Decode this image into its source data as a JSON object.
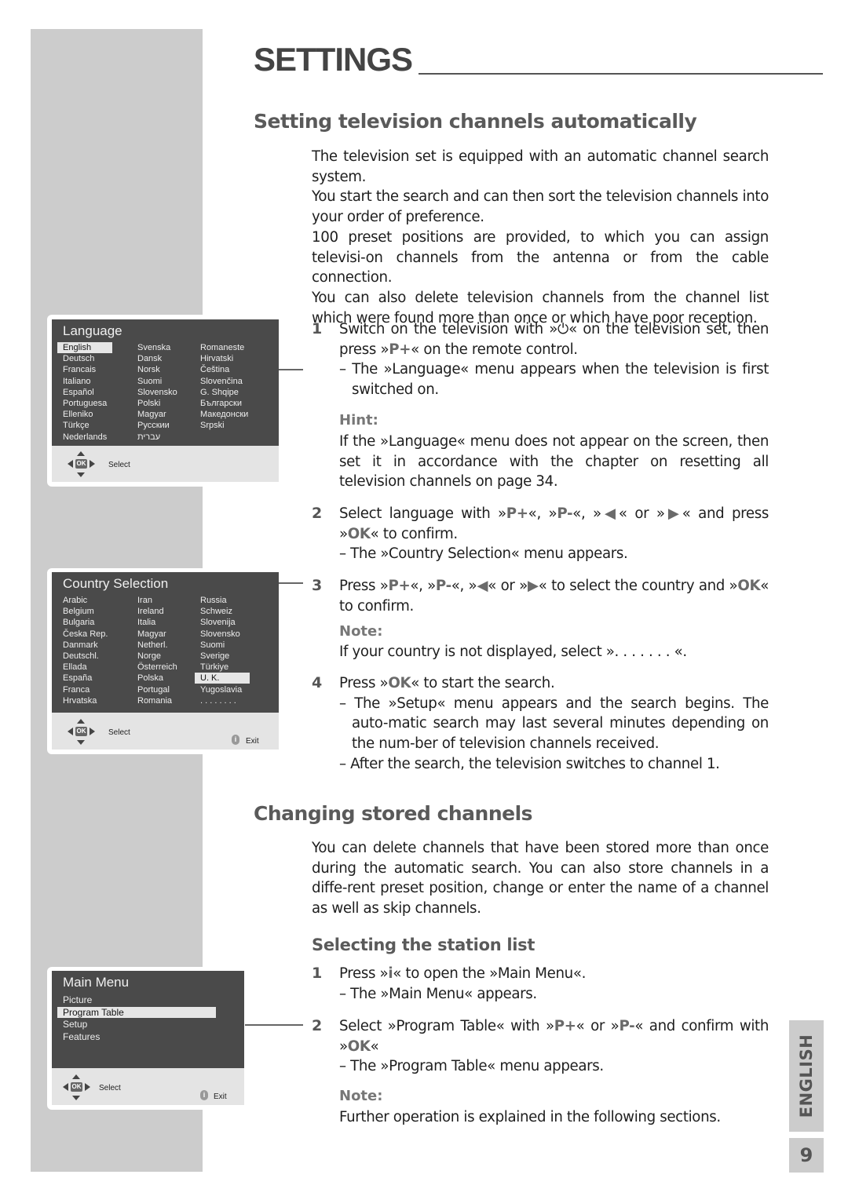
{
  "page": {
    "title": "SETTINGS",
    "language_tab": "ENGLISH",
    "page_number": "9"
  },
  "section1": {
    "heading": "Setting television channels automatically",
    "intro": [
      "The television set is equipped with an automatic channel search system.",
      "You start the search and can then sort the television channels into your order of preference.",
      "100 preset positions are provided, to which you can assign televisi-on channels from the antenna or from the cable connection.",
      "You can also delete television channels from the channel list which were found more than once or which have poor reception."
    ],
    "steps": [
      {
        "num": "1",
        "text_a": "Switch on the television with »",
        "power_symbol": "⏻",
        "text_b": "« on the television set, then press »",
        "key": "P+",
        "text_c": "« on the remote control.",
        "sub": "– The »Language« menu appears when the television is first switched on."
      },
      {
        "num": "2",
        "text_a": "Select language with »",
        "key1": "P+",
        "sep1": "«, »",
        "key2": "P-",
        "sep2": "«, »",
        "key3": "◀",
        "sep3": "« or »",
        "key4": "▶",
        "sep4": "« and press »",
        "key5": "OK",
        "text_end": "« to confirm.",
        "sub": "– The »Country Selection« menu appears."
      },
      {
        "num": "3",
        "text_a": "Press »",
        "key1": "P+",
        "sep1": "«, »",
        "key2": "P-",
        "sep2": "«, »",
        "key3": "◀",
        "sep3": "« or »",
        "key4": "▶",
        "sep4": "« to select the country and »",
        "key5": "OK",
        "text_end": "« to confirm."
      },
      {
        "num": "4",
        "text_a": "Press »",
        "key": "OK",
        "text_b": "« to start the search.",
        "subs": [
          "– The »Setup« menu appears and the search begins. The auto-matic search may last several minutes depending on the num-ber of television channels received.",
          "– After the search, the television switches to channel 1."
        ]
      }
    ],
    "hint": {
      "label": "Hint:",
      "text": "If the »Language« menu does not appear on the screen, then set it in accordance with the chapter on resetting all television channels on page 34."
    },
    "note": {
      "label": "Note:",
      "text": "If your country is not displayed, select ». . . . . . . «."
    }
  },
  "section2": {
    "heading": "Changing stored channels",
    "intro": "You can delete channels that have been stored more than once during the automatic search. You can also store channels in a diffe-rent preset position, change or enter the name of a channel as well as skip channels.",
    "subheading": "Selecting the station list",
    "steps": [
      {
        "num": "1",
        "text_a": "Press »",
        "key": "i",
        "text_b": "« to open the »Main Menu«.",
        "sub": "– The »Main Menu« appears."
      },
      {
        "num": "2",
        "text_a": "Select »Program Table« with »",
        "key1": "P+",
        "sep1": "« or »",
        "key2": "P-",
        "sep2": "« and confirm with »",
        "key3": "OK",
        "text_end": "«",
        "sub": "– The »Program Table« menu appears."
      }
    ],
    "note": {
      "label": "Note:",
      "text": "Further operation is explained in the following sections."
    }
  },
  "language_menu": {
    "title": "Language",
    "columns": [
      [
        "English",
        "Deutsch",
        "Francais",
        "Italiano",
        "Español",
        "Portuguesa",
        "Elleniko",
        "Türkçe",
        "Nederlands"
      ],
      [
        "Svenska",
        "Dansk",
        "Norsk",
        "Suomi",
        "Slovensko",
        "Polski",
        "Magyar",
        "Русскии",
        "עברית"
      ],
      [
        "Romaneste",
        "Hirvatski",
        "Čeština",
        "Slovenčina",
        "G. Shqipe",
        "Български",
        "Македонски",
        "Srpski"
      ]
    ],
    "selected": "English",
    "footer_select": "Select",
    "ok_key": "OK"
  },
  "country_menu": {
    "title": "Country Selection",
    "columns": [
      [
        "Arabic",
        "Belgium",
        "Bulgaria",
        "Česka Rep.",
        "Danmark",
        "Deutschl.",
        "Ellada",
        "España",
        "Franca",
        "Hrvatska"
      ],
      [
        "Iran",
        "Ireland",
        "Italia",
        "Magyar",
        "Netherl.",
        "Norge",
        "Österreich",
        "Polska",
        "Portugal",
        "Romania"
      ],
      [
        "Russia",
        "Schweiz",
        "Slovenija",
        "Slovensko",
        "Suomi",
        "Sverige",
        "Türkiye",
        "U. K.",
        "Yugoslavia",
        ". . . . . . . ."
      ]
    ],
    "selected": "U. K.",
    "footer_select": "Select",
    "footer_exit": "Exit",
    "ok_key": "OK",
    "info_key": "i"
  },
  "main_menu": {
    "title": "Main Menu",
    "items": [
      "Picture",
      "Program Table",
      "Setup",
      "Features"
    ],
    "selected": "Program Table",
    "footer_select": "Select",
    "footer_exit": "Exit",
    "ok_key": "OK",
    "info_key": "i"
  }
}
